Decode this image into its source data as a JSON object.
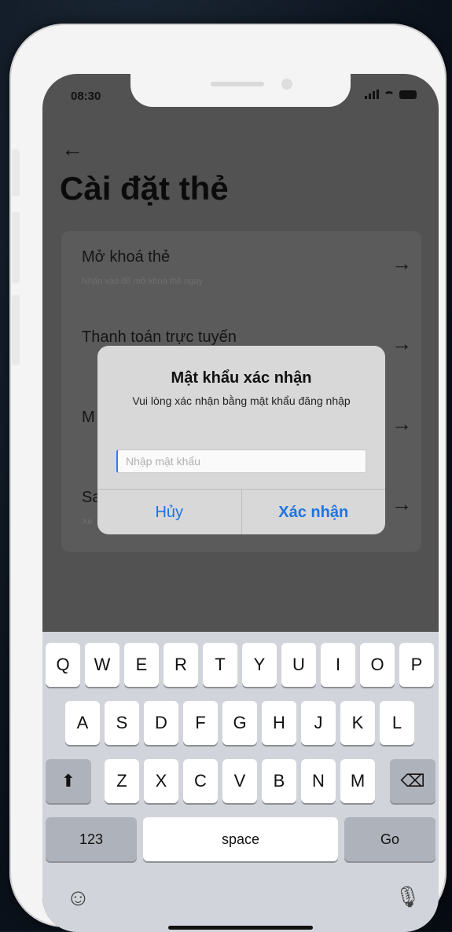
{
  "status_bar": {
    "time": "08:30"
  },
  "page": {
    "back_icon": "←",
    "title": "Cài đặt thẻ"
  },
  "settings_rows": [
    {
      "label": "Mở khoá thẻ",
      "sub": "Nhấn vào để mở khoá thẻ ngay",
      "arrow": "→"
    },
    {
      "label": "Thanh toán trực tuyến",
      "sub": "",
      "arrow": "→"
    },
    {
      "label": "M",
      "sub": "",
      "arrow": "→"
    },
    {
      "label": "Sa",
      "sub": "Xe",
      "arrow": "→"
    }
  ],
  "dialog": {
    "title": "Mật khẩu xác nhận",
    "message": "Vui lòng xác nhận bằng mật khẩu đăng nhập",
    "input_placeholder": "Nhập mật khẩu",
    "cancel_label": "Hủy",
    "confirm_label": "Xác nhận"
  },
  "keyboard": {
    "row1": [
      "Q",
      "W",
      "E",
      "R",
      "T",
      "Y",
      "U",
      "I",
      "O",
      "P"
    ],
    "row2": [
      "A",
      "S",
      "D",
      "F",
      "G",
      "H",
      "J",
      "K",
      "L"
    ],
    "row3": [
      "Z",
      "X",
      "C",
      "V",
      "B",
      "N",
      "M"
    ],
    "shift_icon": "⬆",
    "backspace_icon": "⌫",
    "numbers_label": "123",
    "space_label": "space",
    "go_label": "Go",
    "emoji_icon": "☺",
    "mic_icon": "🎙"
  }
}
